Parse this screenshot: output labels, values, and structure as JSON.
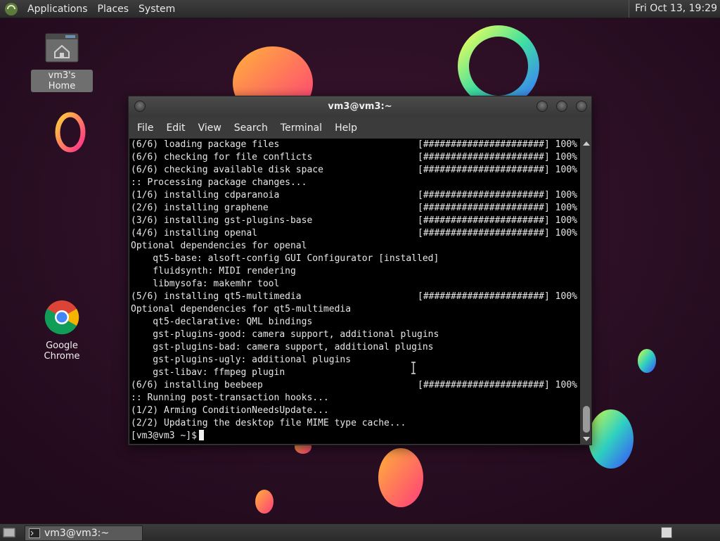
{
  "top_panel": {
    "menus": [
      "Applications",
      "Places",
      "System"
    ],
    "clock": "Fri Oct 13, 19:29"
  },
  "desktop": {
    "icons": [
      {
        "label": "vm3's Home",
        "icon": "home-folder-icon"
      },
      {
        "label": "Google Chrome",
        "icon": "chrome-icon"
      }
    ]
  },
  "window": {
    "title": "vm3@vm3:~",
    "menubar": [
      "File",
      "Edit",
      "View",
      "Search",
      "Terminal",
      "Help"
    ]
  },
  "terminal": {
    "lines": [
      {
        "text": "(6/6) loading package files",
        "bar": "[######################] 100%"
      },
      {
        "text": "(6/6) checking for file conflicts",
        "bar": "[######################] 100%"
      },
      {
        "text": "(6/6) checking available disk space",
        "bar": "[######################] 100%"
      },
      {
        "text": ":: Processing package changes...",
        "bar": ""
      },
      {
        "text": "(1/6) installing cdparanoia",
        "bar": "[######################] 100%"
      },
      {
        "text": "(2/6) installing graphene",
        "bar": "[######################] 100%"
      },
      {
        "text": "(3/6) installing gst-plugins-base",
        "bar": "[######################] 100%"
      },
      {
        "text": "(4/6) installing openal",
        "bar": "[######################] 100%"
      },
      {
        "text": "Optional dependencies for openal",
        "bar": ""
      },
      {
        "text": "    qt5-base: alsoft-config GUI Configurator [installed]",
        "bar": ""
      },
      {
        "text": "    fluidsynth: MIDI rendering",
        "bar": ""
      },
      {
        "text": "    libmysofa: makemhr tool",
        "bar": ""
      },
      {
        "text": "(5/6) installing qt5-multimedia",
        "bar": "[######################] 100%"
      },
      {
        "text": "Optional dependencies for qt5-multimedia",
        "bar": ""
      },
      {
        "text": "    qt5-declarative: QML bindings",
        "bar": ""
      },
      {
        "text": "    gst-plugins-good: camera support, additional plugins",
        "bar": ""
      },
      {
        "text": "    gst-plugins-bad: camera support, additional plugins",
        "bar": ""
      },
      {
        "text": "    gst-plugins-ugly: additional plugins",
        "bar": ""
      },
      {
        "text": "    gst-libav: ffmpeg plugin",
        "bar": ""
      },
      {
        "text": "(6/6) installing beebeep",
        "bar": "[######################] 100%"
      },
      {
        "text": ":: Running post-transaction hooks...",
        "bar": ""
      },
      {
        "text": "(1/2) Arming ConditionNeedsUpdate...",
        "bar": ""
      },
      {
        "text": "(2/2) Updating the desktop file MIME type cache...",
        "bar": ""
      }
    ],
    "prompt": "[vm3@vm3 ~]$"
  },
  "taskbar": {
    "task_label": "vm3@vm3:~"
  },
  "colors": {
    "wallpaper": "#2a1024",
    "terminal_bg": "#000000",
    "terminal_fg": "#e6e6e6",
    "panel": "#333333"
  }
}
